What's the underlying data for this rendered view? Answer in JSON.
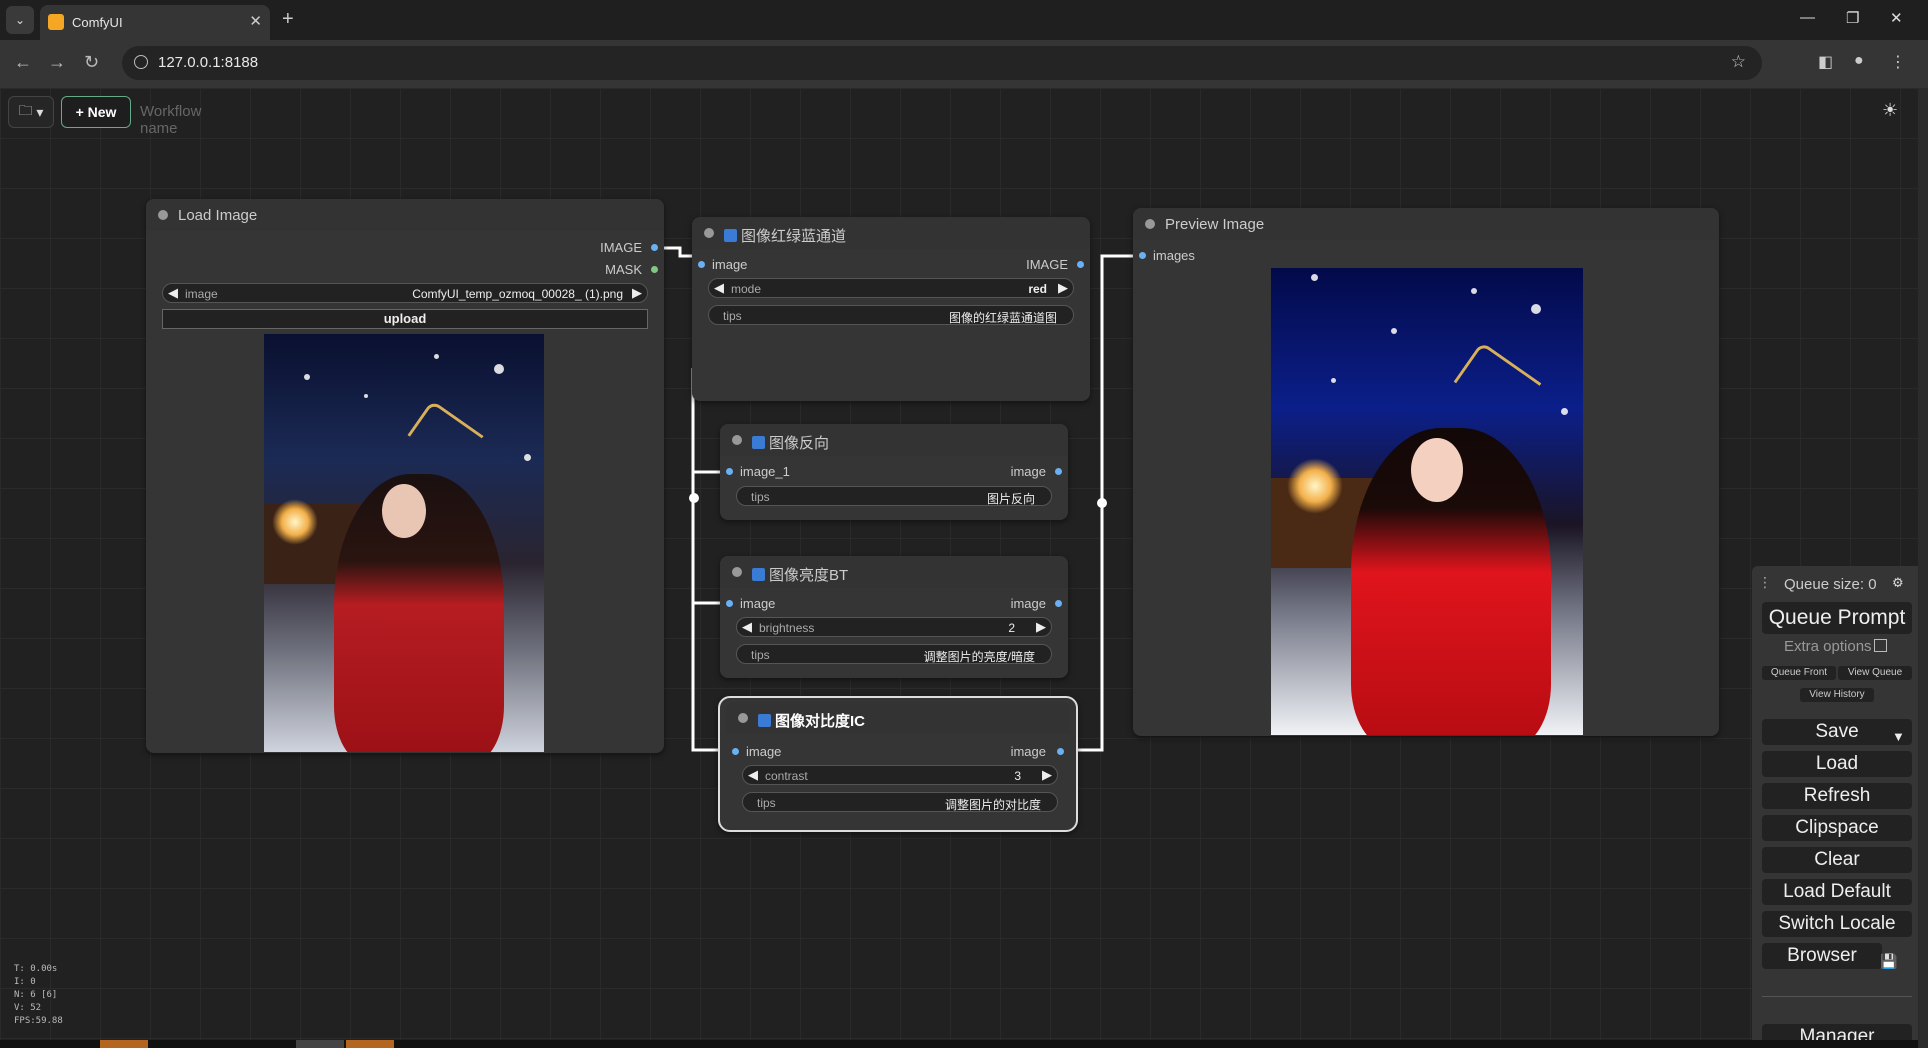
{
  "browser": {
    "tab_title": "ComfyUI",
    "url": "127.0.0.1:8188"
  },
  "app": {
    "new_button": "New",
    "workflow_placeholder": "Workflow name"
  },
  "nodes": {
    "load_image": {
      "title": "Load Image",
      "outputs": [
        "IMAGE",
        "MASK"
      ],
      "image_widget": {
        "label": "image",
        "value": "ComfyUI_temp_ozmoq_00028_ (1).png"
      },
      "upload_label": "upload"
    },
    "rgb_channel": {
      "title": "图像红绿蓝通道",
      "input": "image",
      "output": "IMAGE",
      "mode": {
        "label": "mode",
        "value": "red"
      },
      "tips": {
        "label": "tips",
        "value": "图像的红绿蓝通道图"
      }
    },
    "invert": {
      "title": "图像反向",
      "input": "image_1",
      "output": "image",
      "tips": {
        "label": "tips",
        "value": "图片反向"
      }
    },
    "brightness": {
      "title": "图像亮度BT",
      "input": "image",
      "output": "image",
      "brightness": {
        "label": "brightness",
        "value": "2"
      },
      "tips": {
        "label": "tips",
        "value": "调整图片的亮度/暗度"
      }
    },
    "contrast": {
      "title": "图像对比度IC",
      "input": "image",
      "output": "image",
      "contrast": {
        "label": "contrast",
        "value": "3"
      },
      "tips": {
        "label": "tips",
        "value": "调整图片的对比度"
      }
    },
    "preview": {
      "title": "Preview Image",
      "input": "images"
    }
  },
  "queue_panel": {
    "queue_size": "Queue size: 0",
    "queue_prompt": "Queue Prompt",
    "extra_options": "Extra options",
    "queue_front": "Queue Front",
    "view_queue": "View Queue",
    "view_history": "View History",
    "save": "Save",
    "load": "Load",
    "refresh": "Refresh",
    "clipspace": "Clipspace",
    "clear": "Clear",
    "load_default": "Load Default",
    "switch_locale": "Switch Locale",
    "browser": "Browser",
    "manager": "Manager"
  },
  "stats": {
    "t": "T: 0.00s",
    "i": "I: 0",
    "n": "N: 6 [6]",
    "v": "V: 52",
    "fps": "FPS:59.88"
  },
  "colors": {
    "link": "#ffffff",
    "slot_image": "#6ab0f3",
    "slot_mask": "#81c784",
    "accent_new": "#66aa88"
  }
}
